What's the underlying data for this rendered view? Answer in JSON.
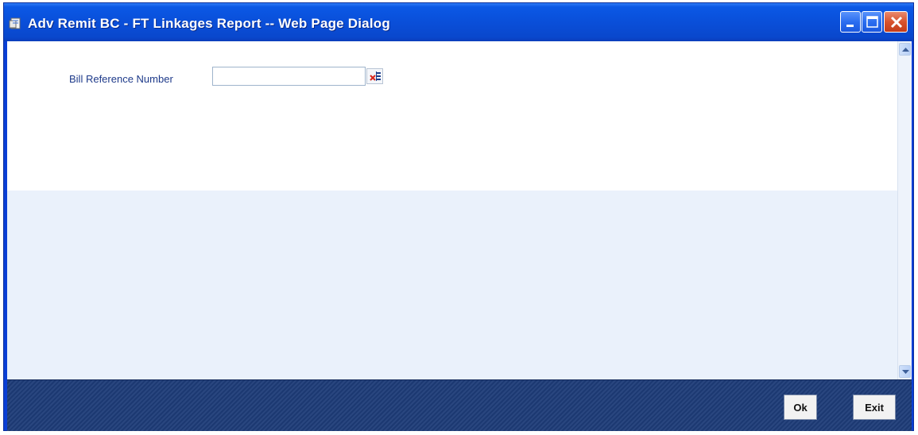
{
  "window": {
    "title": "Adv Remit BC - FT Linkages Report -- Web Page Dialog"
  },
  "form": {
    "bill_reference_label": "Bill Reference Number",
    "bill_reference_value": ""
  },
  "footer": {
    "ok_label": "Ok",
    "exit_label": "Exit"
  },
  "icons": {
    "window": "document-icon",
    "lov": "list-of-values-icon",
    "minimize": "minimize-icon",
    "maximize": "maximize-icon",
    "close": "close-icon"
  },
  "colors": {
    "titlebar": "#0a4fd9",
    "footer": "#1e3c78",
    "lower_panel": "#eaf1fb",
    "label_text": "#1e3a8a"
  }
}
